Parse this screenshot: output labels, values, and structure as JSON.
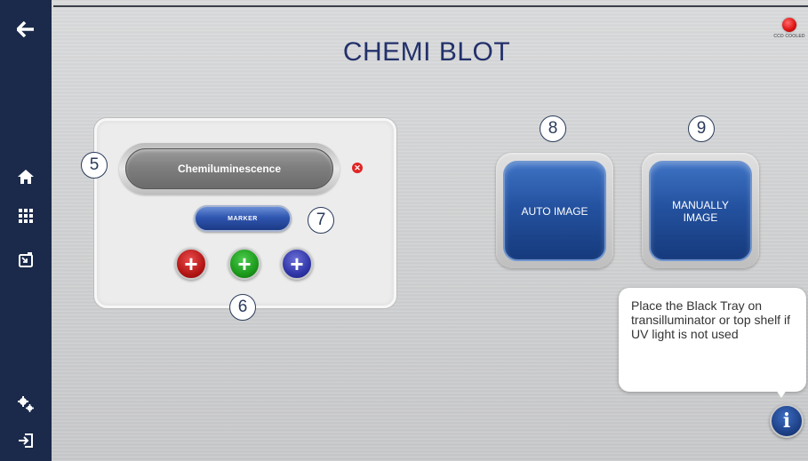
{
  "header": {
    "title": "CHEMI BLOT",
    "ccd_status_label": "CCD COOLED",
    "ccd_status_color": "#e11616"
  },
  "sidebar": {
    "items": [
      {
        "id": "back",
        "icon": "arrow-left-icon"
      },
      {
        "id": "home",
        "icon": "home-icon"
      },
      {
        "id": "apps",
        "icon": "grid-icon"
      },
      {
        "id": "gallery",
        "icon": "image-import-icon"
      },
      {
        "id": "settings",
        "icon": "gears-icon"
      },
      {
        "id": "logout",
        "icon": "sign-in-icon"
      }
    ]
  },
  "panel": {
    "mode_label": "Chemiluminescence",
    "marker_label": "MARKER",
    "color_buttons": [
      {
        "color": "red",
        "symbol": "+"
      },
      {
        "color": "green",
        "symbol": "+"
      },
      {
        "color": "blue",
        "symbol": "+"
      }
    ]
  },
  "callouts": {
    "five": "5",
    "six": "6",
    "seven": "7",
    "eight": "8",
    "nine": "9"
  },
  "actions": {
    "auto_image": "AUTO IMAGE",
    "manually_image_line1": "MANUALLY",
    "manually_image_line2": "IMAGE"
  },
  "tooltip": {
    "text": "Place the Black Tray on transilluminator or top shelf if UV light is not used"
  },
  "info_button": {
    "symbol": "i"
  },
  "colors": {
    "sidebar": "#1b2a4a",
    "title": "#23316b",
    "primary_button": "#2452a0"
  }
}
